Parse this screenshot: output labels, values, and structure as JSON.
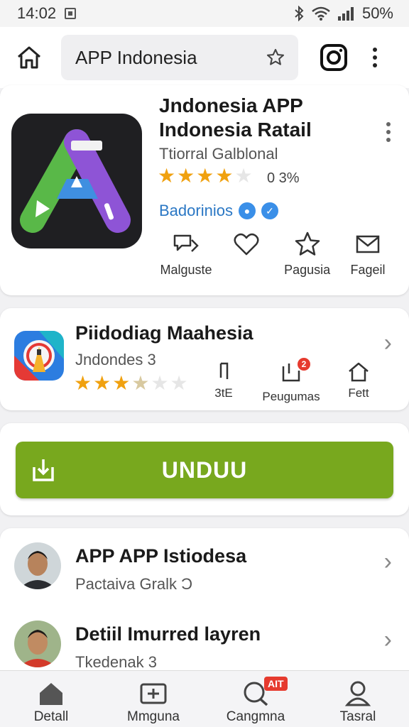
{
  "status": {
    "time": "14:02",
    "battery": "50%"
  },
  "search": {
    "value": "APP Indonesia"
  },
  "app": {
    "title": "Jndonesia APP Indonesia Ratail",
    "subtitle": "Ttiorral Galblonal",
    "rating_stars": 4,
    "rating_text": "0 3%",
    "developer": "Badorinios",
    "actions": [
      {
        "label": "Malguste",
        "icon": "share-icon"
      },
      {
        "label": "Pagusia",
        "icon": "star-icon"
      },
      {
        "label": "Fageil",
        "icon": "mail-icon"
      }
    ]
  },
  "related": {
    "title": "Piidodiag Maahesia",
    "subtitle": "Jndondes 3",
    "rating_stars": 3,
    "actions": [
      {
        "label": "3tE",
        "icon": "music-note-icon"
      },
      {
        "label": "Peugumas",
        "icon": "notification-icon",
        "badge": "2"
      },
      {
        "label": "Fett",
        "icon": "home-icon"
      }
    ]
  },
  "download": {
    "label": "UNDUU"
  },
  "list": [
    {
      "title": "APP APP Istiodesa",
      "subtitle": "Pactaiva Gralk Ɔ"
    },
    {
      "title": "Detiil Imurred layren",
      "subtitle": "Tkedenak 3"
    }
  ],
  "bottom_nav": [
    {
      "label": "Detall",
      "icon": "home-icon"
    },
    {
      "label": "Mmguna",
      "icon": "apps-icon"
    },
    {
      "label": "Cangmna",
      "icon": "search-icon",
      "badge": "AIT"
    },
    {
      "label": "Tasral",
      "icon": "profile-icon"
    }
  ],
  "colors": {
    "accent_green": "#78a81e",
    "star": "#f0a10f",
    "link_blue": "#2a77c4"
  }
}
